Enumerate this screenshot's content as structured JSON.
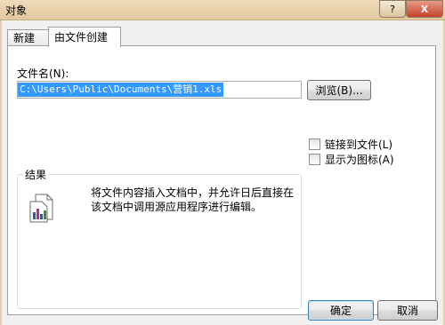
{
  "window": {
    "title": "对象",
    "help_label": "?",
    "close_label": "X"
  },
  "tabs": [
    {
      "label": "新建"
    },
    {
      "label": "由文件创建"
    }
  ],
  "form": {
    "filename_label": "文件名(N):",
    "filename_value": "C:\\Users\\Public\\Documents\\营销1.xls",
    "browse_label": "浏览(B)...",
    "link_to_file_label": "链接到文件(L)",
    "link_to_file_checked": false,
    "display_as_icon_label": "显示为图标(A)",
    "display_as_icon_checked": false
  },
  "result": {
    "title": "结果",
    "description": "将文件内容插入文档中，并允许日后直接在该文档中调用源应用程序进行编辑。",
    "icon": "embedded-document-icon"
  },
  "footer": {
    "ok_label": "确定",
    "cancel_label": "取消"
  }
}
